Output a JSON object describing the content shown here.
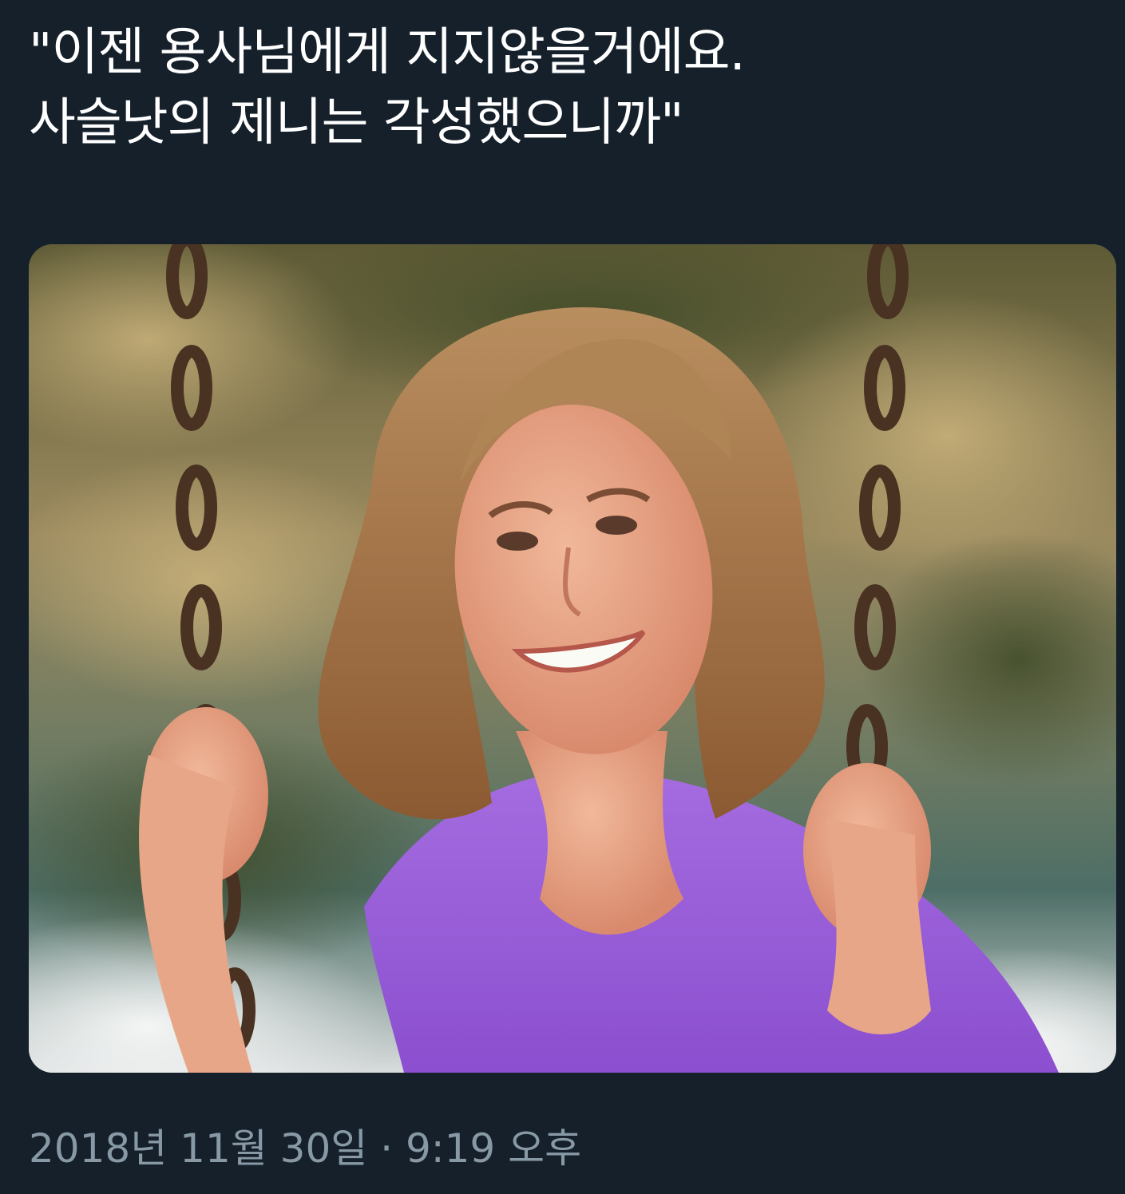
{
  "tweet": {
    "text_lines": [
      "\"이젠 용사님에게 지지않을거에요.",
      "사슬낫의 제니는 각성했으니까\""
    ],
    "timestamp": "2018년 11월 30일 · 9:19 오후"
  },
  "colors": {
    "background": "#15202b",
    "text": "#ffffff",
    "timestamp": "#8899a6",
    "shirt": "#9a5fd6",
    "hair": "#a8794a"
  }
}
